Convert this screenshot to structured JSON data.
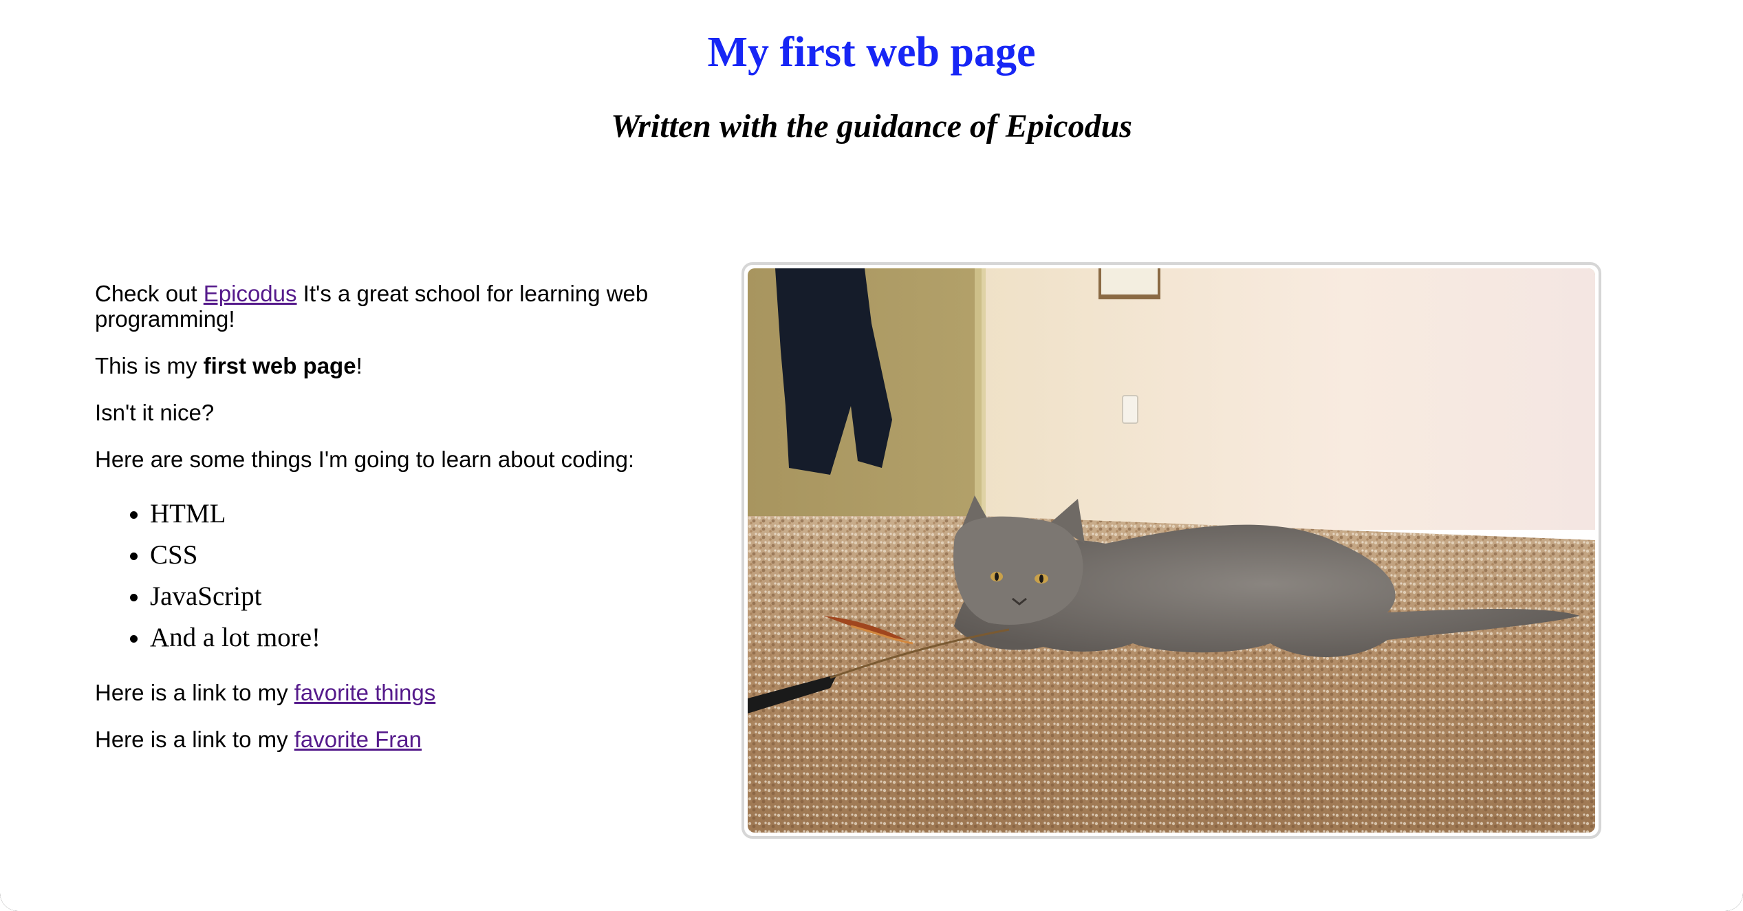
{
  "header": {
    "title": "My first web page",
    "subtitle": "Written with the guidance of Epicodus"
  },
  "content": {
    "intro": {
      "prefix": "Check out ",
      "link_text": "Epicodus",
      "suffix": " It's a great school for learning web programming!"
    },
    "line2": {
      "prefix": "This is my ",
      "bold": "first web page",
      "suffix": "!"
    },
    "line3": "Isn't it nice?",
    "list_intro": "Here are some things I'm going to learn about coding:",
    "list_items": [
      "HTML",
      "CSS",
      "JavaScript",
      "And a lot more!"
    ],
    "link1": {
      "prefix": "Here is a link to my ",
      "link_text": "favorite things"
    },
    "link2": {
      "prefix": "Here is a link to my ",
      "link_text": "favorite Fran"
    }
  },
  "image": {
    "subject": "kitten-on-carpet-photo"
  },
  "colors": {
    "title": "#1726f5",
    "visited_link": "#551a8b",
    "image_border": "#d6d6d6"
  }
}
